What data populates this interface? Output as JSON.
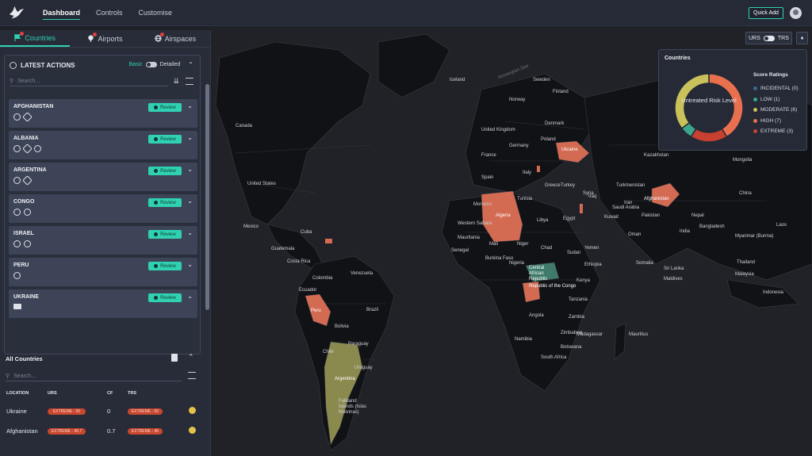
{
  "topbar": {
    "nav": [
      {
        "label": "Dashboard",
        "active": true
      },
      {
        "label": "Controls",
        "active": false
      },
      {
        "label": "Customise",
        "active": false
      }
    ],
    "quick_add": "Quick Add"
  },
  "sidebar": {
    "tabs": [
      {
        "label": "Countries",
        "active": true,
        "icon": "flag-icon"
      },
      {
        "label": "Airports",
        "active": false,
        "icon": "plane-pin-icon"
      },
      {
        "label": "Airspaces",
        "active": false,
        "icon": "globe-icon"
      }
    ],
    "latest_actions": {
      "title": "LATEST ACTIONS",
      "mode_basic": "Basic",
      "mode_detailed": "Detailed",
      "search_placeholder": "Search...",
      "review_label": "Review",
      "countries": [
        {
          "name": "AFGHANISTAN",
          "icons": [
            "globe",
            "plane"
          ]
        },
        {
          "name": "ALBANIA",
          "icons": [
            "globe",
            "plane",
            "globe"
          ]
        },
        {
          "name": "ARGENTINA",
          "icons": [
            "globe",
            "plane"
          ]
        },
        {
          "name": "CONGO",
          "icons": [
            "globe",
            "globe"
          ]
        },
        {
          "name": "ISRAEL",
          "icons": [
            "globe",
            "globe"
          ]
        },
        {
          "name": "PERU",
          "icons": [
            "globe"
          ]
        },
        {
          "name": "UKRAINE",
          "icons": [
            "card"
          ]
        }
      ]
    },
    "all_countries": {
      "title": "All Countries",
      "search_placeholder": "Search...",
      "columns": [
        "LOCATION",
        "URS",
        "CF",
        "TRS"
      ],
      "rows": [
        {
          "location": "Ukraine",
          "urs": "EXTREME - 50",
          "cf": "0",
          "trs": "EXTREME - 50"
        },
        {
          "location": "Afghanistan",
          "urs": "EXTREME - 46.7",
          "cf": "0.7",
          "trs": "EXTREME - 46"
        }
      ]
    }
  },
  "map": {
    "toggle_left": "URS",
    "toggle_right": "TRS",
    "labels": [
      {
        "text": "Norwegian Sea",
        "type": "sea"
      },
      {
        "text": "Iceland"
      },
      {
        "text": "Sweden"
      },
      {
        "text": "Finland"
      },
      {
        "text": "Norway"
      },
      {
        "text": "Denmark"
      },
      {
        "text": "United Kingdom"
      },
      {
        "text": "Poland"
      },
      {
        "text": "Germany"
      },
      {
        "text": "France"
      },
      {
        "text": "Ukraine",
        "type": "em"
      },
      {
        "text": "Spain"
      },
      {
        "text": "Italy"
      },
      {
        "text": "Greece"
      },
      {
        "text": "Turkey"
      },
      {
        "text": "Canada"
      },
      {
        "text": "United States"
      },
      {
        "text": "Mexico"
      },
      {
        "text": "Cuba"
      },
      {
        "text": "Guatemala"
      },
      {
        "text": "Costa Rica"
      },
      {
        "text": "Colombia"
      },
      {
        "text": "Venezuela"
      },
      {
        "text": "Ecuador"
      },
      {
        "text": "Peru",
        "type": "em"
      },
      {
        "text": "Brazil"
      },
      {
        "text": "Bolivia"
      },
      {
        "text": "Chile"
      },
      {
        "text": "Paraguay"
      },
      {
        "text": "Uruguay"
      },
      {
        "text": "Argentina",
        "type": "em"
      },
      {
        "text": "Falkland Islands (Islas Malvinas)"
      },
      {
        "text": "Morocco"
      },
      {
        "text": "Algeria",
        "type": "em"
      },
      {
        "text": "Tunisia"
      },
      {
        "text": "Libya"
      },
      {
        "text": "Egypt"
      },
      {
        "text": "Western Sahara"
      },
      {
        "text": "Mauritania"
      },
      {
        "text": "Mali"
      },
      {
        "text": "Niger"
      },
      {
        "text": "Chad"
      },
      {
        "text": "Sudan"
      },
      {
        "text": "Senegal"
      },
      {
        "text": "Burkina Faso"
      },
      {
        "text": "Nigeria"
      },
      {
        "text": "Central African Republic",
        "type": "em"
      },
      {
        "text": "Republic of the Congo",
        "type": "em"
      },
      {
        "text": "Ethiopia"
      },
      {
        "text": "Somalia"
      },
      {
        "text": "Kenya"
      },
      {
        "text": "Tanzania"
      },
      {
        "text": "Angola"
      },
      {
        "text": "Zambia"
      },
      {
        "text": "Namibia"
      },
      {
        "text": "Zimbabwe"
      },
      {
        "text": "Botswana"
      },
      {
        "text": "South Africa"
      },
      {
        "text": "Madagascar"
      },
      {
        "text": "Mauritius"
      },
      {
        "text": "Saudi Arabia"
      },
      {
        "text": "Yemen"
      },
      {
        "text": "Oman"
      },
      {
        "text": "Iraq"
      },
      {
        "text": "Iran"
      },
      {
        "text": "Syria"
      },
      {
        "text": "Kuwait"
      },
      {
        "text": "Kazakhstan"
      },
      {
        "text": "Turkmenistan"
      },
      {
        "text": "Afghanistan",
        "type": "em"
      },
      {
        "text": "Pakistan"
      },
      {
        "text": "India"
      },
      {
        "text": "Nepal"
      },
      {
        "text": "Bangladesh"
      },
      {
        "text": "Myanmar (Burma)"
      },
      {
        "text": "Thailand"
      },
      {
        "text": "Sri Lanka"
      },
      {
        "text": "Maldives"
      },
      {
        "text": "Malaysia"
      },
      {
        "text": "Indonesia"
      },
      {
        "text": "Mongolia"
      },
      {
        "text": "China"
      },
      {
        "text": "Laos"
      }
    ]
  },
  "legend": {
    "title": "Countries",
    "center_label": "Untreated Risk Level",
    "score_title": "Score Ratings",
    "colors": {
      "incidental": "#3a6b8a",
      "low": "#3aa78c",
      "moderate": "#c9c25a",
      "high": "#d9674e",
      "extreme": "#c8402f"
    },
    "items": [
      {
        "label": "INCIDENTAL (0)",
        "value": 0,
        "color": "#3a6b8a"
      },
      {
        "label": "LOW (1)",
        "value": 1,
        "color": "#3aa78c"
      },
      {
        "label": "MODERATE (6)",
        "value": 6,
        "color": "#c9c25a"
      },
      {
        "label": "HIGH (7)",
        "value": 7,
        "color": "#e8704f"
      },
      {
        "label": "EXTREME (3)",
        "value": 3,
        "color": "#c8402f"
      }
    ]
  }
}
